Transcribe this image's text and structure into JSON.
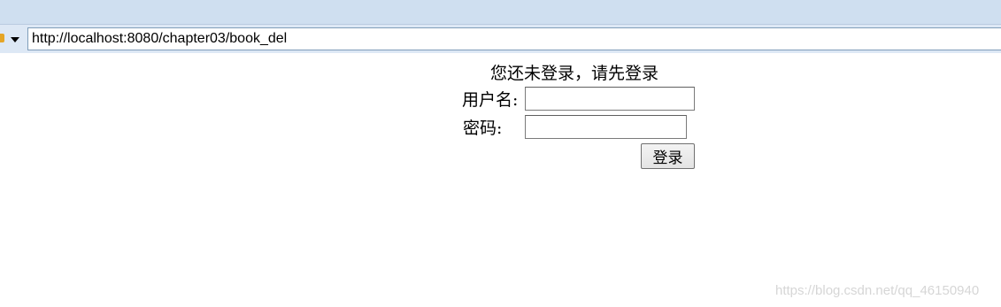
{
  "browser": {
    "address": "http://localhost:8080/chapter03/book_del",
    "icons": [
      "page-icon",
      "dropdown-arrow-icon"
    ]
  },
  "login": {
    "title": "您还未登录，请先登录",
    "username_label": "用户名:",
    "username_value": "",
    "password_label": "密码:",
    "password_value": "",
    "submit_label": "登录"
  },
  "watermark": "https://blog.csdn.net/qq_46150940"
}
